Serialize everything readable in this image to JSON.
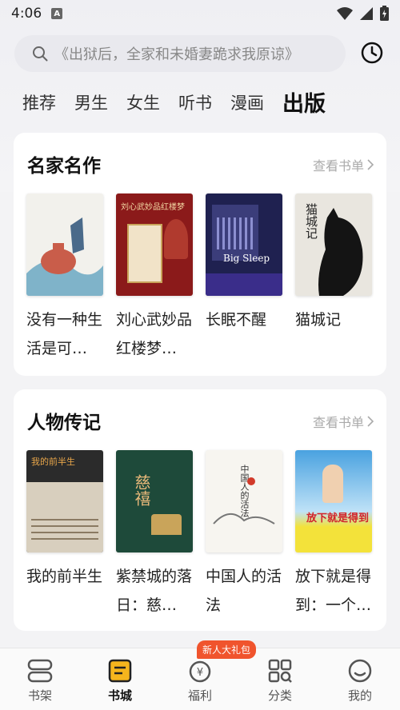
{
  "status_bar": {
    "time": "4:06",
    "notification_letter": "A"
  },
  "search": {
    "placeholder": "《出狱后，全家和未婚妻跪求我原谅》"
  },
  "tabs": [
    {
      "label": "推荐"
    },
    {
      "label": "男生"
    },
    {
      "label": "女生"
    },
    {
      "label": "听书"
    },
    {
      "label": "漫画"
    },
    {
      "label": "出版",
      "active": true
    }
  ],
  "sections": [
    {
      "title": "名家名作",
      "more": "查看书单",
      "books": [
        {
          "title": "没有一种生活是可…",
          "cover_color": "#f2f1ec"
        },
        {
          "title": "刘心武妙品红楼梦…",
          "cover_color": "#8b1a1a",
          "cover_text": "刘心武妙品红楼梦"
        },
        {
          "title": "长眠不醒",
          "cover_color": "#1f2150",
          "cover_text": "Big Sleep"
        },
        {
          "title": "猫城记",
          "cover_color": "#e9e6df",
          "cover_text": "猫城记"
        }
      ]
    },
    {
      "title": "人物传记",
      "more": "查看书单",
      "books": [
        {
          "title": "我的前半生",
          "cover_color": "#2b2b2b",
          "cover_text": "我的前半生"
        },
        {
          "title": "紫禁城的落日：慈…",
          "cover_color": "#1e4a3a",
          "cover_text": "慈禧"
        },
        {
          "title": "中国人的活法",
          "cover_color": "#f7f5f0",
          "cover_text": "中国人的活法"
        },
        {
          "title": "放下就是得到：一个…",
          "cover_color": "#4aa2e0",
          "cover_text": "放下就是得到"
        }
      ]
    }
  ],
  "bottom_nav": [
    {
      "label": "书架"
    },
    {
      "label": "书城",
      "active": true
    },
    {
      "label": "福利",
      "badge": "新人大礼包"
    },
    {
      "label": "分类"
    },
    {
      "label": "我的"
    }
  ]
}
